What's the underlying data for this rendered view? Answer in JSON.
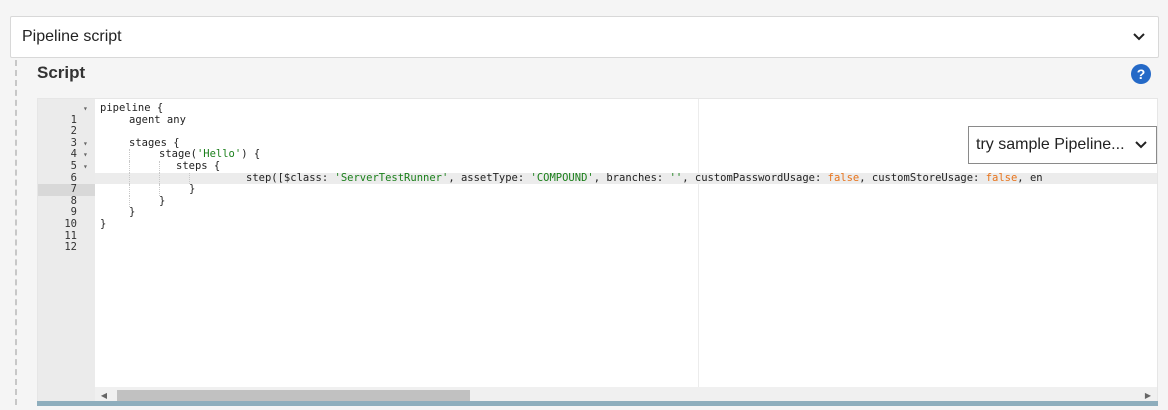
{
  "definition": {
    "selected": "Pipeline script"
  },
  "script_section": {
    "title": "Script",
    "help": "?"
  },
  "sample_select": {
    "selected": "try sample Pipeline..."
  },
  "editor": {
    "active_line": 7,
    "lines": [
      {
        "n": "1",
        "fold": true
      },
      {
        "n": "2",
        "fold": false
      },
      {
        "n": "3",
        "fold": false
      },
      {
        "n": "4",
        "fold": true
      },
      {
        "n": "5",
        "fold": true
      },
      {
        "n": "6",
        "fold": true
      },
      {
        "n": "7",
        "fold": false
      },
      {
        "n": "8",
        "fold": false
      },
      {
        "n": "9",
        "fold": false
      },
      {
        "n": "10",
        "fold": false
      },
      {
        "n": "11",
        "fold": false
      },
      {
        "n": "12",
        "fold": false
      }
    ],
    "code": {
      "l1": "pipeline {",
      "l2": "agent any",
      "l4": "stages {",
      "l5_a": "stage(",
      "l5_str": "'Hello'",
      "l5_b": ") {",
      "l6": "steps {",
      "l7_a": "step([$class: ",
      "l7_s1": "'ServerTestRunner'",
      "l7_b": ", assetType: ",
      "l7_s2": "'COMPOUND'",
      "l7_c": ", branches: ",
      "l7_s3": "''",
      "l7_d": ", customPasswordUsage: ",
      "l7_k1": "false",
      "l7_e": ", customStoreUsage: ",
      "l7_k2": "false",
      "l7_f": ", en",
      "l8": "}",
      "l9": "}",
      "l10": "}",
      "l11": "}"
    }
  },
  "icons": {
    "definition_chevron": "chevron-down-icon",
    "sample_chevron": "chevron-down-icon",
    "help": "help-icon",
    "fold": "fold-arrow-icon"
  },
  "colors": {
    "string": "#1a7f1a",
    "keyword": "#e8731a",
    "help": "#2469c7"
  }
}
